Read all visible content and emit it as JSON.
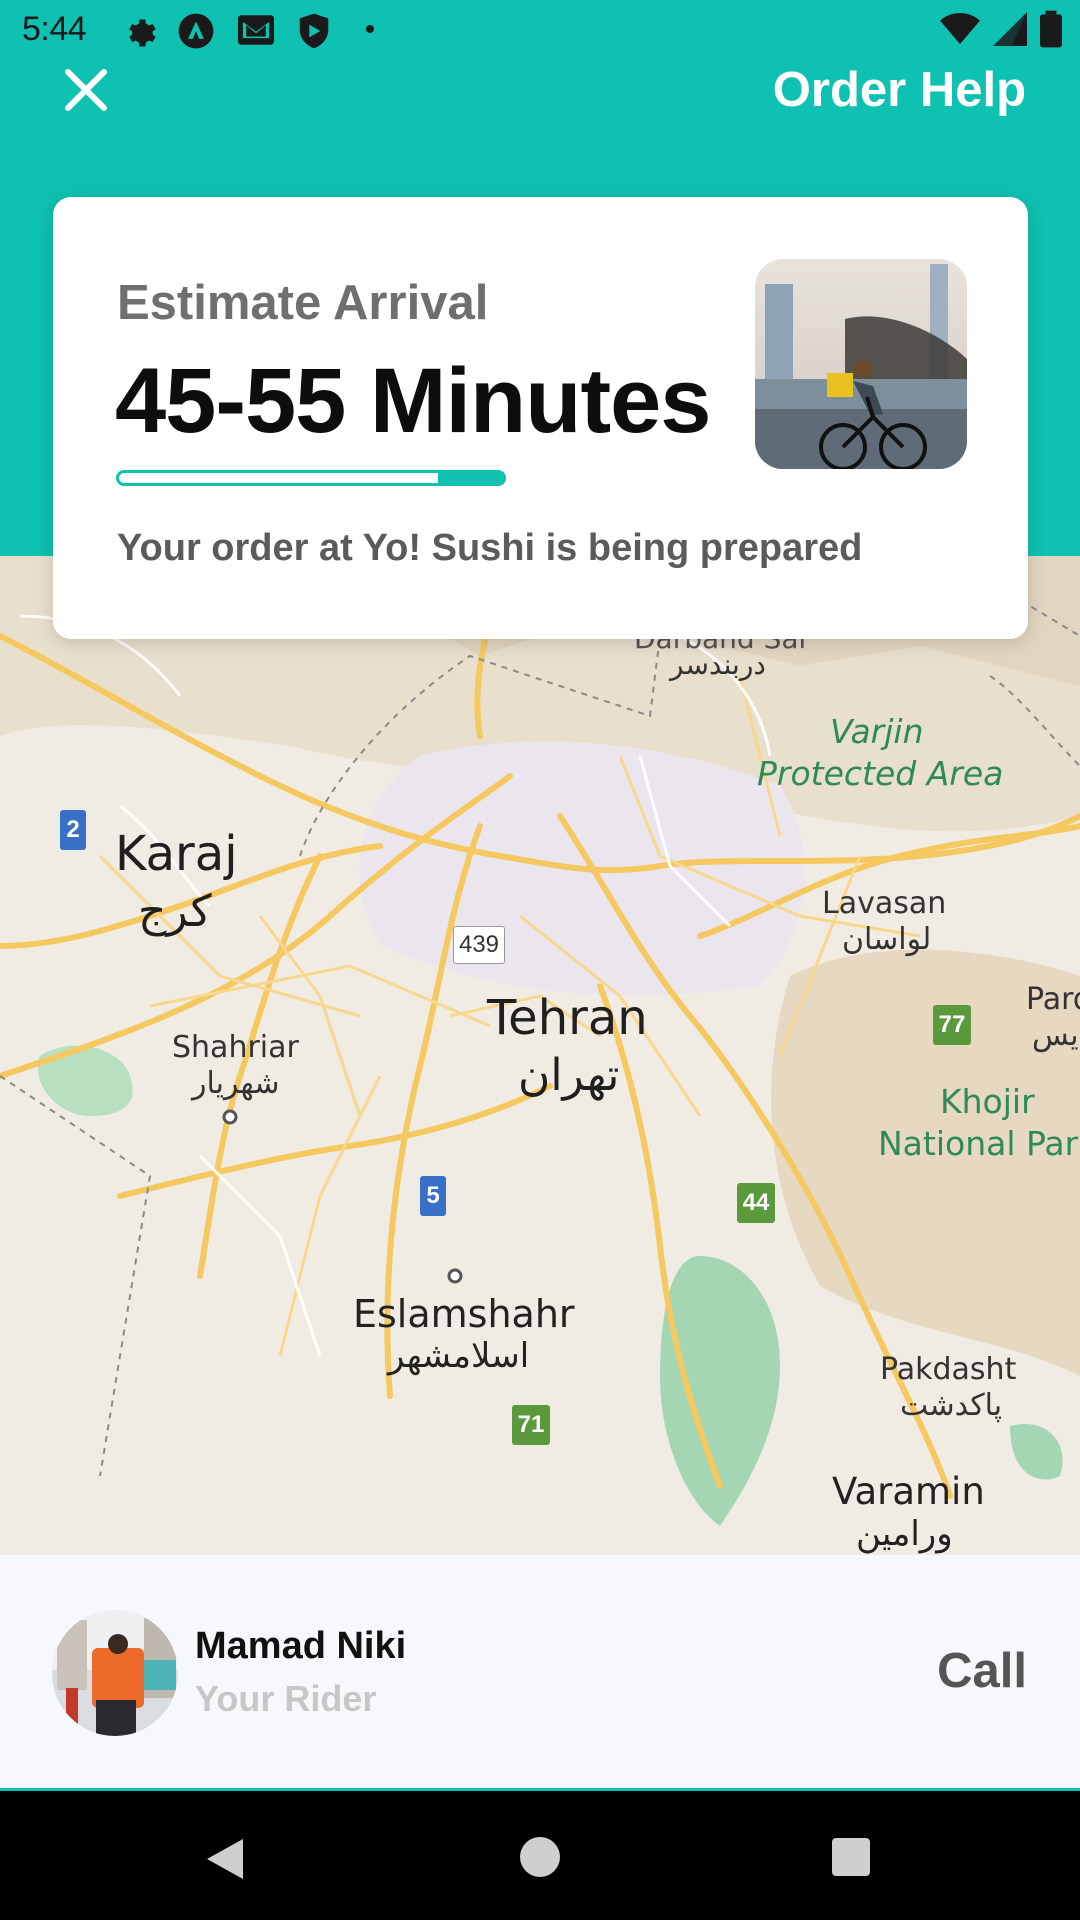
{
  "status_bar": {
    "time": "5:44",
    "icons": [
      "settings-icon",
      "vpn-icon",
      "mail-icon",
      "shield-icon",
      "dot-icon"
    ],
    "right_icons": [
      "wifi-icon",
      "signal-icon",
      "battery-icon"
    ]
  },
  "header": {
    "close_icon": "close-icon",
    "help_label": "Order Help",
    "accent_color": "#0fc1b0"
  },
  "arrival_card": {
    "label": "Estimate Arrival",
    "time_range": "45-55 Minutes",
    "progress_fraction": 0.83,
    "status_text": "Your order at Yo! Sushi is being prepared"
  },
  "map": {
    "labels": {
      "darband_en": "Darband Sar",
      "darband_fa": "دربندسر",
      "varjin": "Varjin",
      "varjin2": "Protected Area",
      "karaj_en": "Karaj",
      "karaj_fa": "کرج",
      "lavasan_en": "Lavasan",
      "lavasan_fa": "لواسان",
      "tehran_en": "Tehran",
      "tehran_fa": "تهران",
      "pardis_en": "Pard",
      "pardis_fa": "دیس",
      "shahriar_en": "Shahriar",
      "shahriar_fa": "شهریار",
      "khojir": "Khojir",
      "khojir2": "National Par",
      "eslamshahr_en": "Eslamshahr",
      "eslamshahr_fa": "اسلامشهر",
      "pakdasht_en": "Pakdasht",
      "pakdasht_fa": "پاکدشت",
      "varamin_en": "Varamin",
      "varamin_fa": "ورامین"
    },
    "shields": {
      "r2": "2",
      "r439": "439",
      "r77": "77",
      "r5": "5",
      "r44": "44",
      "r71": "71"
    }
  },
  "rider": {
    "name": "Mamad Niki",
    "role": "Your Rider",
    "call_label": "Call"
  },
  "nav_bar": {
    "back_icon": "back-triangle-icon",
    "home_icon": "home-circle-icon",
    "recent_icon": "recents-square-icon"
  }
}
